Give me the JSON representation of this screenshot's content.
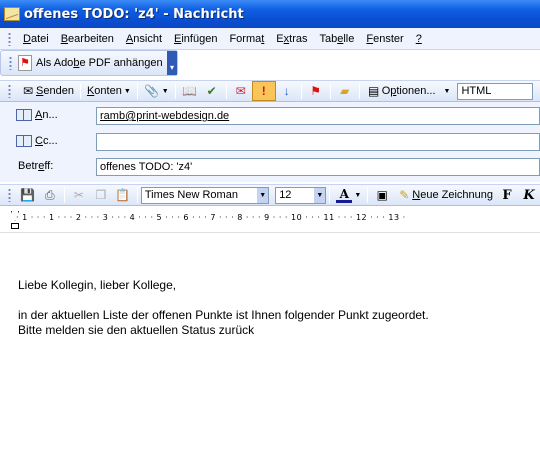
{
  "window": {
    "title": "offenes TODO: 'z4' - Nachricht"
  },
  "menu": [
    {
      "pre": "",
      "u": "D",
      "post": "atei"
    },
    {
      "pre": "",
      "u": "B",
      "post": "earbeiten"
    },
    {
      "pre": "",
      "u": "A",
      "post": "nsicht"
    },
    {
      "pre": "",
      "u": "E",
      "post": "infügen"
    },
    {
      "pre": "Forma",
      "u": "t",
      "post": ""
    },
    {
      "pre": "E",
      "u": "x",
      "post": "tras"
    },
    {
      "pre": "Tab",
      "u": "e",
      "post": "lle"
    },
    {
      "pre": "",
      "u": "F",
      "post": "enster"
    },
    {
      "pre": "",
      "u": "?",
      "post": ""
    }
  ],
  "pdf_toolbar": {
    "label_pre": "Als Ado",
    "label_u": "b",
    "label_post": "e PDF anhängen"
  },
  "standard_toolbar": {
    "send": {
      "u": "S",
      "post": "enden"
    },
    "accounts": {
      "u": "K",
      "post": "onten"
    },
    "options": {
      "pre": "O",
      "u": "p",
      "post": "tionen..."
    },
    "format": "HTML"
  },
  "fields": {
    "to_label": {
      "u": "A",
      "post": "n..."
    },
    "to_value": "ramb@print-webdesign.de",
    "cc_label": {
      "u": "C",
      "post": "c..."
    },
    "cc_value": "",
    "subject_label": {
      "pre": "Betr",
      "u": "e",
      "post": "ff:"
    },
    "subject_value": "offenes TODO: 'z4'"
  },
  "format_toolbar": {
    "font": "Times New Roman",
    "size": "12",
    "new_drawing": {
      "u": "N",
      "post": "eue Zeichnung"
    }
  },
  "ruler": {
    "text": "· 1 · · · 1 · · · 2 · · · 3 · · · 4 · · · 5 · · · 6 · · · 7 · · · 8 · · · 9 · · · 10 · · · 11 · · · 12 · · · 13 ·"
  },
  "body": {
    "greeting": "Liebe Kollegin, lieber Kollege,",
    "line1": "in der aktuellen Liste der offenen Punkte ist Ihnen folgender Punkt zugeordet.",
    "line2": "Bitte melden sie den aktuellen Status zurück"
  }
}
